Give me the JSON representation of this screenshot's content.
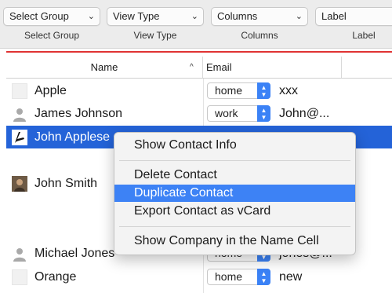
{
  "toolbar": {
    "popups": [
      {
        "value": "Select Group",
        "label": "Select Group"
      },
      {
        "value": "View Type",
        "label": "View Type"
      },
      {
        "value": "Columns",
        "label": "Columns"
      },
      {
        "value": "Label",
        "label": "Label"
      }
    ],
    "chevron": "⌃⌄"
  },
  "table": {
    "headers": {
      "name": "Name",
      "email": "Email",
      "sort_indicator": "^"
    },
    "rows": [
      {
        "name": "Apple",
        "icon": "blank-avatar-icon",
        "type": "home",
        "email": "xxx"
      },
      {
        "name": "James Johnson",
        "icon": "person-silhouette-icon",
        "type": "work",
        "email": "John@..."
      },
      {
        "name": "John Applese",
        "icon": "pen-logo-icon",
        "type": "",
        "email": ""
      },
      {
        "name": "John Smith",
        "icon": "photo-avatar-icon",
        "type": "",
        "email": ""
      },
      {
        "name": "Michael Jones",
        "icon": "person-silhouette-icon",
        "type": "home",
        "email": "jones@..."
      },
      {
        "name": "Orange",
        "icon": "blank-avatar-icon",
        "type": "home",
        "email": "new"
      }
    ]
  },
  "context_menu": {
    "items": [
      "Show Contact Info",
      "Delete Contact",
      "Duplicate Contact",
      "Export Contact as vCard",
      "Show Company in the Name Cell"
    ],
    "highlighted": "Duplicate Contact"
  },
  "colors": {
    "selection": "#2463d8",
    "menu_highlight": "#3d82f5",
    "accent_line": "#e03333",
    "stepper": "#3b82f6"
  }
}
